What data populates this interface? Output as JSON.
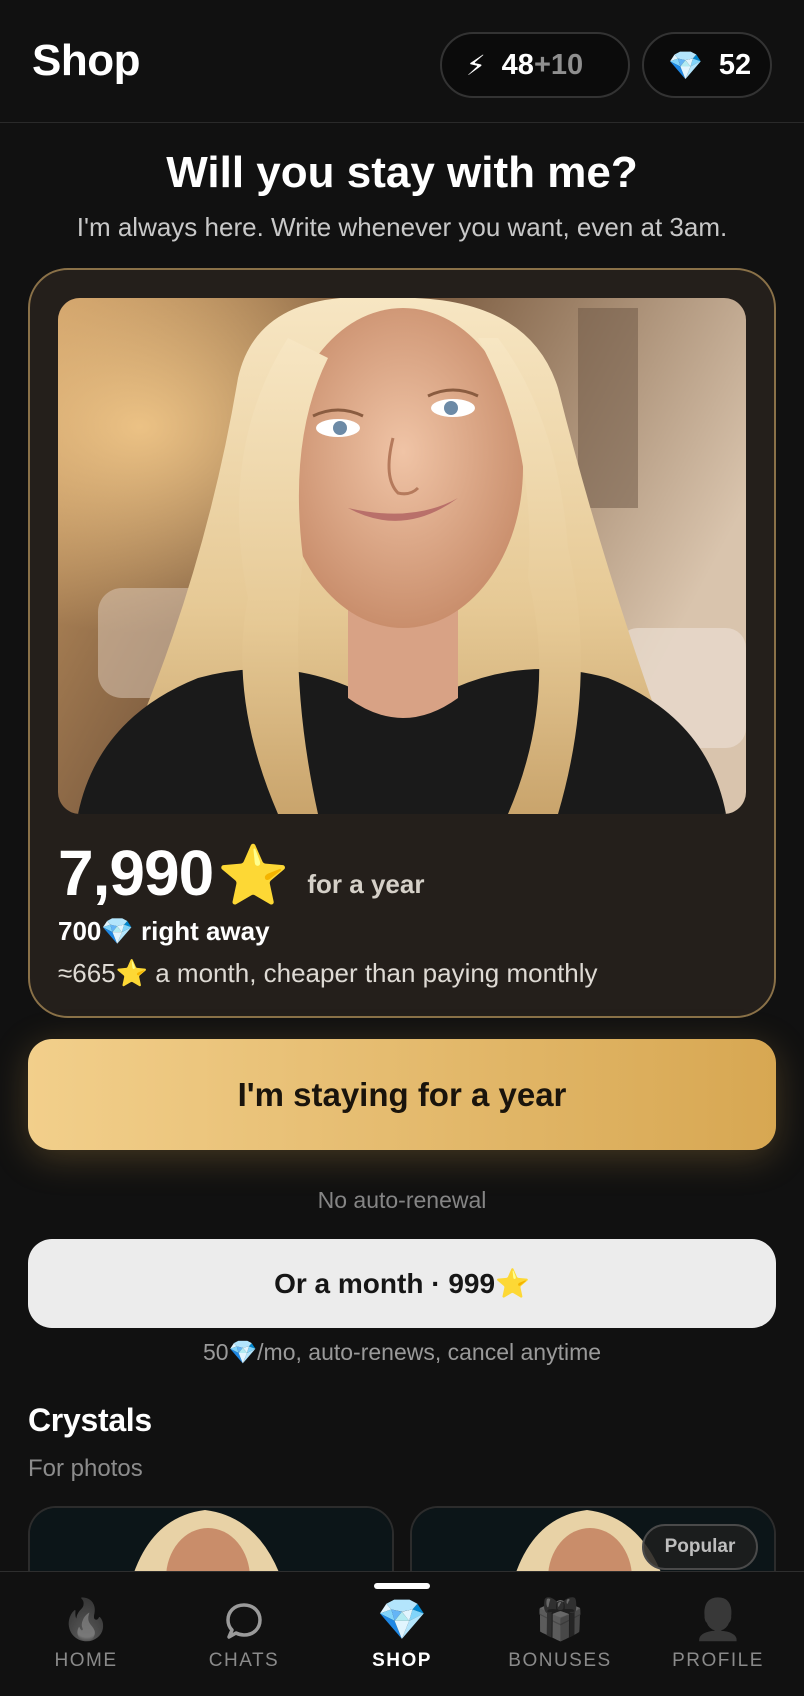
{
  "header": {
    "title": "Shop",
    "energy": {
      "icon": "lightning-icon",
      "value": "48",
      "bonus": "+10"
    },
    "gems": {
      "icon": "gem-icon",
      "value": "52"
    }
  },
  "hero": {
    "title": "Will you stay with me?",
    "subtitle": "I'm always here. Write whenever you want, even at 3am."
  },
  "offer": {
    "price": "7,990",
    "price_icon": "⭐",
    "period": "for a year",
    "gems_line": "700💎 right away",
    "monthly_line": "≈665⭐ a month, cheaper than paying monthly"
  },
  "actions": {
    "year_label": "I'm staying for a year",
    "no_renewal": "No auto-renewal",
    "month_label": "Or a month · 999⭐",
    "month_note": "50💎/mo, auto-renews, cancel anytime"
  },
  "crystals": {
    "title": "Crystals",
    "subtitle": "For photos",
    "badge": "Popular"
  },
  "nav": {
    "items": [
      {
        "label": "HOME",
        "icon": "flame-icon",
        "glyph": "🔥"
      },
      {
        "label": "CHATS",
        "icon": "chat-bubble-icon"
      },
      {
        "label": "SHOP",
        "icon": "gem-icon",
        "glyph": "💎",
        "active": true
      },
      {
        "label": "BONUSES",
        "icon": "gift-icon",
        "glyph": "🎁"
      },
      {
        "label": "PROFILE",
        "icon": "person-icon",
        "glyph": "👤"
      }
    ]
  },
  "colors": {
    "background": "#111111",
    "card_border": "#8a7148",
    "card_bg": "#241f1b",
    "gold_start": "#f2cf8b",
    "gold_end": "#d7a752"
  }
}
